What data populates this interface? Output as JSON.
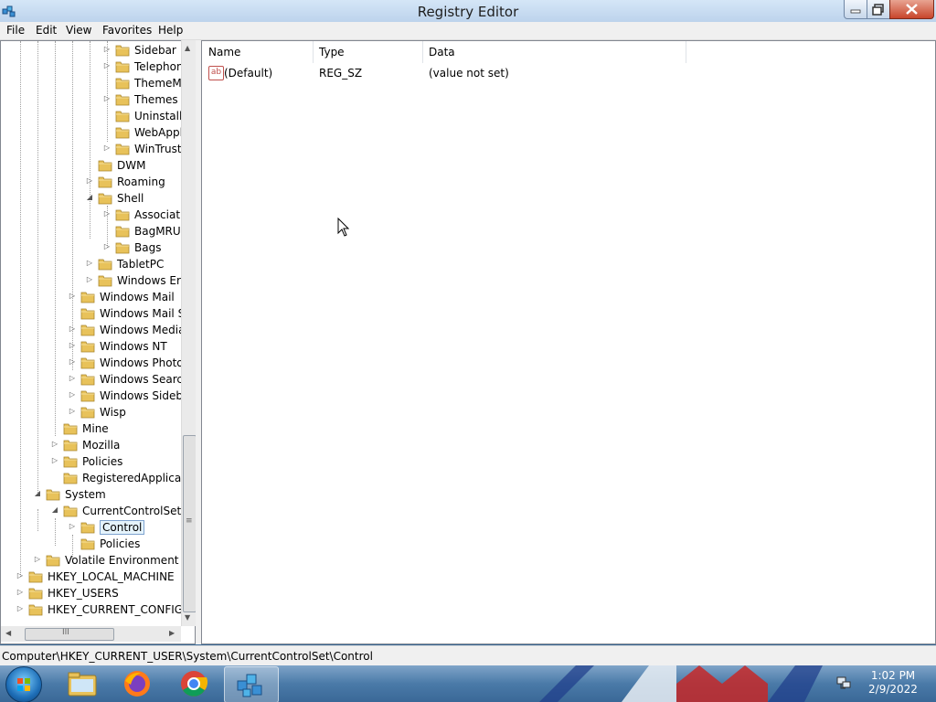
{
  "window": {
    "title": "Registry Editor"
  },
  "menu": [
    "File",
    "Edit",
    "View",
    "Favorites",
    "Help"
  ],
  "tree": {
    "items": [
      {
        "label": "Sidebar",
        "expander": "collapsed"
      },
      {
        "label": "Telephon",
        "expander": "collapsed"
      },
      {
        "label": "ThemeM",
        "expander": "none"
      },
      {
        "label": "Themes",
        "expander": "collapsed"
      },
      {
        "label": "Uninstall",
        "expander": "none"
      },
      {
        "label": "WebAppl",
        "expander": "none"
      },
      {
        "label": "WinTrust",
        "expander": "collapsed"
      },
      {
        "label": "DWM",
        "expander": "none"
      },
      {
        "label": "Roaming",
        "expander": "collapsed"
      },
      {
        "label": "Shell",
        "expander": "expanded"
      },
      {
        "label": "Associati",
        "expander": "collapsed"
      },
      {
        "label": "BagMRU",
        "expander": "none"
      },
      {
        "label": "Bags",
        "expander": "collapsed"
      },
      {
        "label": "TabletPC",
        "expander": "collapsed"
      },
      {
        "label": "Windows Err",
        "expander": "collapsed"
      },
      {
        "label": "Windows Mail",
        "expander": "collapsed"
      },
      {
        "label": "Windows Mail Se",
        "expander": "none"
      },
      {
        "label": "Windows Media",
        "expander": "collapsed"
      },
      {
        "label": "Windows NT",
        "expander": "collapsed"
      },
      {
        "label": "Windows Photo",
        "expander": "collapsed"
      },
      {
        "label": "Windows Search",
        "expander": "collapsed"
      },
      {
        "label": "Windows Sideba",
        "expander": "collapsed"
      },
      {
        "label": "Wisp",
        "expander": "collapsed"
      },
      {
        "label": "Mine",
        "expander": "none"
      },
      {
        "label": "Mozilla",
        "expander": "collapsed"
      },
      {
        "label": "Policies",
        "expander": "collapsed"
      },
      {
        "label": "RegisteredApplicatio",
        "expander": "none"
      },
      {
        "label": "System",
        "expander": "expanded"
      },
      {
        "label": "CurrentControlSet",
        "expander": "expanded"
      },
      {
        "label": "Control",
        "expander": "collapsed",
        "selected": true
      },
      {
        "label": "Policies",
        "expander": "none"
      },
      {
        "label": "Volatile Environment",
        "expander": "collapsed"
      },
      {
        "label": "HKEY_LOCAL_MACHINE",
        "expander": "collapsed"
      },
      {
        "label": "HKEY_USERS",
        "expander": "collapsed"
      },
      {
        "label": "HKEY_CURRENT_CONFIG",
        "expander": "collapsed"
      }
    ],
    "scrollbar_thumb_glyph": "≡",
    "hscroll_thumb_glyph": "III"
  },
  "list": {
    "columns": [
      "Name",
      "Type",
      "Data"
    ],
    "rows": [
      {
        "icon": "string-value-icon",
        "icon_text": "ab",
        "name": "(Default)",
        "type": "REG_SZ",
        "data": "(value not set)"
      }
    ]
  },
  "status": {
    "path": "Computer\\HKEY_CURRENT_USER\\System\\CurrentControlSet\\Control"
  },
  "taskbar": {
    "apps": [
      "file-explorer-icon",
      "firefox-icon",
      "chrome-icon",
      "registry-editor-icon"
    ],
    "active_app": "registry-editor-icon"
  },
  "clock": {
    "time": "1:02 PM",
    "date": "2/9/2022"
  },
  "colors": {
    "selection_fill": "#e5f3fb",
    "selection_border": "#7da2ce",
    "folder": "#e8c25a",
    "taskbar": "#4a7aa8"
  }
}
